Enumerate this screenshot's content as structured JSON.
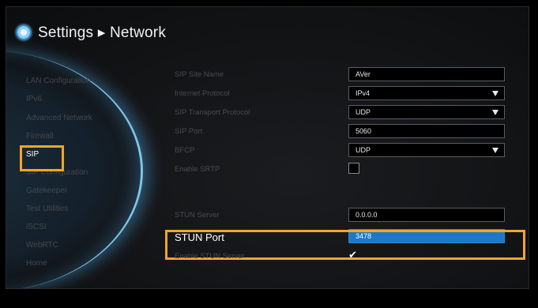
{
  "header": {
    "title": "Settings ▸ Network",
    "icon": "gear-icon"
  },
  "sidebar": {
    "items": [
      {
        "label": "LAN Configuration"
      },
      {
        "label": "IPv6"
      },
      {
        "label": "Advanced Network"
      },
      {
        "label": "Firewall"
      },
      {
        "label": "SIP"
      },
      {
        "label": "SIP Configuration"
      },
      {
        "label": "Gatekeeper"
      },
      {
        "label": "Test Utilities"
      },
      {
        "label": "iSCSI"
      },
      {
        "label": "WebRTC"
      },
      {
        "label": "Home"
      }
    ],
    "active_item": "SIP"
  },
  "form": {
    "sip_site_name": {
      "label": "SIP Site Name",
      "value": "AVer"
    },
    "internet_protocol": {
      "label": "Internet Protocol",
      "value": "IPv4"
    },
    "sip_transport_protocol": {
      "label": "SIP Transport Protocol",
      "value": "UDP"
    },
    "sip_port": {
      "label": "SIP Port",
      "value": "5060"
    },
    "bfcp": {
      "label": "BFCP",
      "value": "UDP"
    },
    "enable_srtp": {
      "label": "Enable SRTP",
      "checked": false
    },
    "stun_server": {
      "label": "STUN Server",
      "value": "0.0.0.0"
    },
    "stun_port": {
      "label": "STUN Port",
      "value": "3478"
    },
    "enable_stun_server": {
      "label": "Enable STUN Server",
      "checked": true,
      "mark": "✔"
    }
  },
  "colors": {
    "highlight": "#f5a623",
    "selected_field": "#1e78c7",
    "accent_glow": "#7fc6ee"
  }
}
